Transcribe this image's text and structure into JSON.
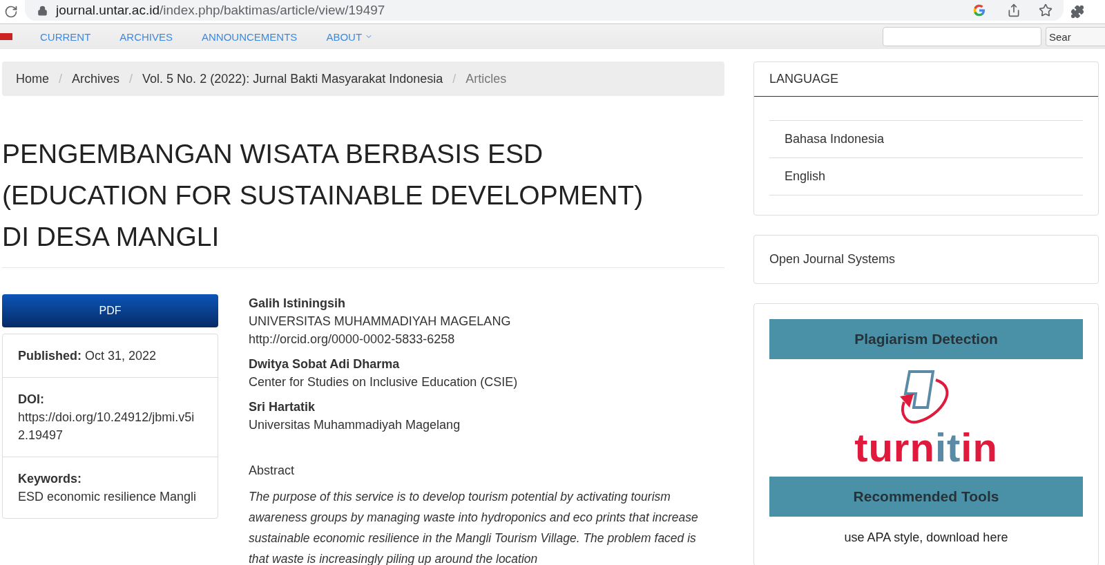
{
  "browser": {
    "url_host": "journal.untar.ac.id",
    "url_path": "/index.php/baktimas/article/view/19497"
  },
  "nav": {
    "items": [
      {
        "label": "CURRENT",
        "has_caret": false
      },
      {
        "label": "ARCHIVES",
        "has_caret": false
      },
      {
        "label": "ANNOUNCEMENTS",
        "has_caret": false
      },
      {
        "label": "ABOUT",
        "has_caret": true
      }
    ],
    "search_button": "Sear"
  },
  "breadcrumb_separator": "/",
  "breadcrumb": [
    {
      "label": "Home",
      "current": false
    },
    {
      "label": "Archives",
      "current": false
    },
    {
      "label": "Vol. 5 No. 2 (2022): Jurnal Bakti Masyarakat Indonesia",
      "current": false
    },
    {
      "label": "Articles",
      "current": true
    }
  ],
  "article": {
    "title": "PENGEMBANGAN WISATA BERBASIS ESD (EDUCATION FOR SUSTAINABLE DEVELOPMENT) DI DESA MANGLI",
    "pdf_button": "PDF",
    "meta": [
      {
        "label": "Published:",
        "value": "Oct 31, 2022",
        "inline": true
      },
      {
        "label": "DOI:",
        "value": "https://doi.org/10.24912/jbmi.v5i2.19497",
        "inline": false
      },
      {
        "label": "Keywords:",
        "value": "ESD economic resilience Mangli",
        "inline": false
      }
    ],
    "authors": [
      {
        "name": "Galih Istiningsih",
        "affiliation": "UNIVERSITAS MUHAMMADIYAH MAGELANG",
        "orcid": "http://orcid.org/0000-0002-5833-6258"
      },
      {
        "name": "Dwitya Sobat Adi Dharma",
        "affiliation": "Center for Studies on Inclusive Education (CSIE)"
      },
      {
        "name": "Sri Hartatik",
        "affiliation": "Universitas Muhammadiyah Magelang"
      }
    ],
    "abstract": {
      "heading": "Abstract",
      "text": "The purpose of this service is to develop tourism potential by activating tourism awareness groups by managing waste into hydroponics and eco prints that increase sustainable economic resilience in the Mangli Tourism Village. The problem faced is that waste is increasingly piling up around the location"
    }
  },
  "sidebar": {
    "language": {
      "title": "LANGUAGE",
      "items": [
        "Bahasa Indonesia",
        "English"
      ]
    },
    "ojs_link": "Open Journal Systems",
    "plagiarism": {
      "heading": "Plagiarism Detection",
      "logo_text": [
        {
          "text": "turn",
          "color": "#e01a3c"
        },
        {
          "text": "it",
          "color": "#5a8aa6"
        },
        {
          "text": "in",
          "color": "#e01a3c"
        }
      ],
      "tools_heading": "Recommended Tools",
      "tools_link": "use APA style, download here"
    }
  }
}
